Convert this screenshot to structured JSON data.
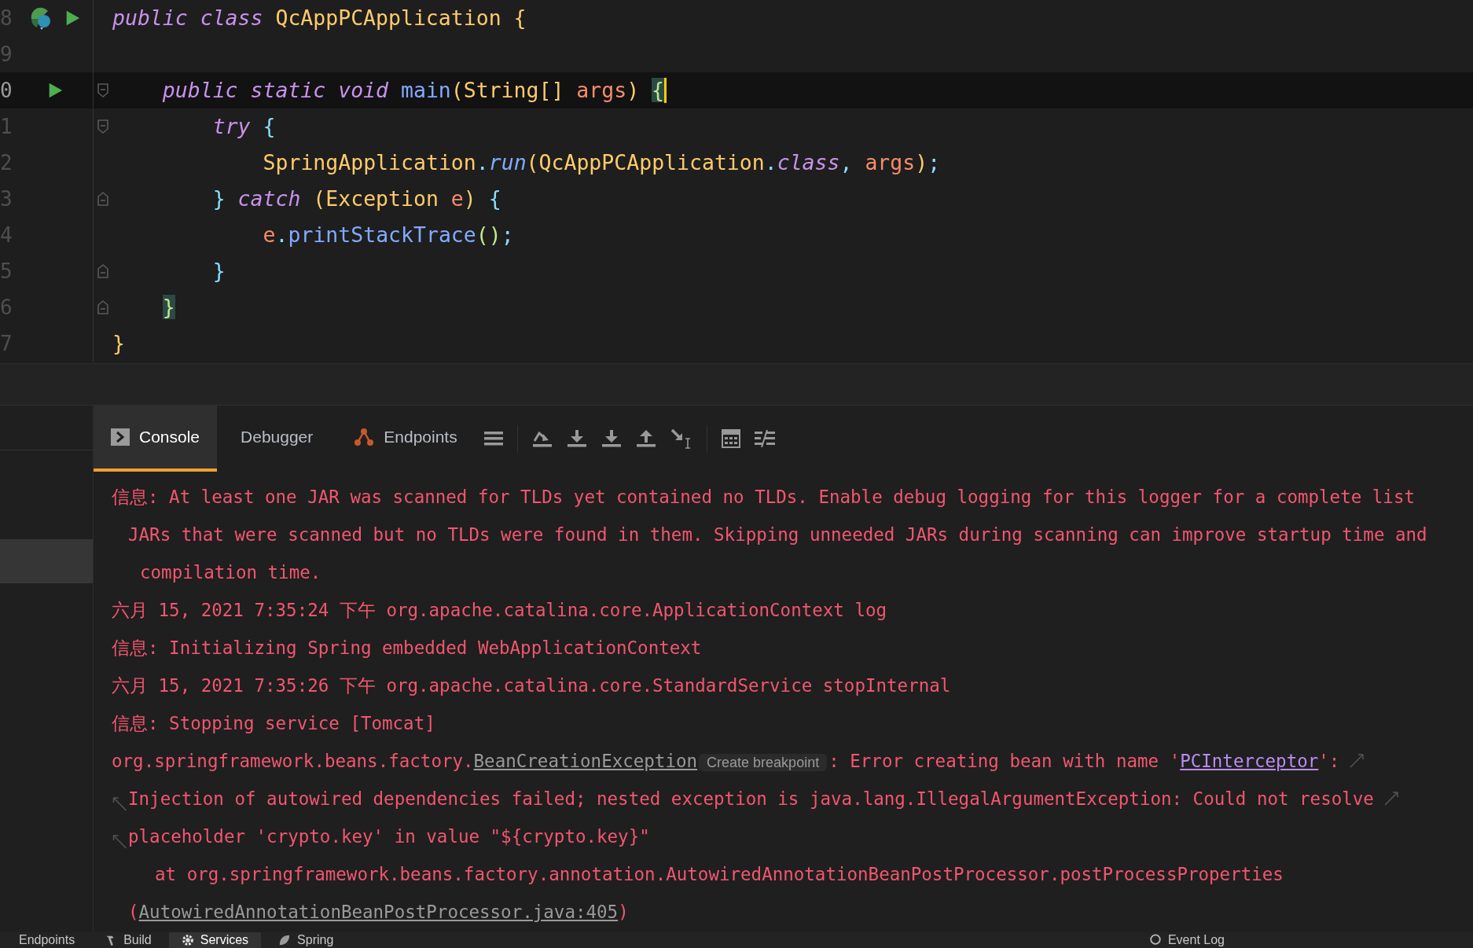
{
  "editor": {
    "lines": [
      {
        "number": "8",
        "gutter": [
          {
            "kind": "class"
          },
          {
            "kind": "run"
          }
        ],
        "kind": "top",
        "current": false,
        "caret": false,
        "tokens": [
          {
            "kind": "kw",
            "t": "public class "
          },
          {
            "kind": "type",
            "t": "QcAppPCApplication "
          },
          {
            "kind": "p1",
            "t": "{"
          }
        ]
      },
      {
        "number": "9",
        "kind": "top",
        "current": false,
        "caret": false
      },
      {
        "number": "0",
        "gutter": [
          {
            "kind": "run"
          }
        ],
        "fold": {
          "kind": "open"
        },
        "kind": "member",
        "current": true,
        "caret": true,
        "tokens": [
          {
            "kind": "kw",
            "t": "public static void "
          },
          {
            "kind": "fn",
            "t": "main"
          },
          {
            "kind": "p1",
            "t": "(String[] "
          },
          {
            "kind": "param",
            "t": "args"
          },
          {
            "kind": "p1",
            "t": ") "
          },
          {
            "kind": "match",
            "t": "{"
          }
        ]
      },
      {
        "number": "1",
        "fold": {
          "kind": "open"
        },
        "kind": "block",
        "current": false,
        "caret": false,
        "tokens": [
          {
            "kind": "kw",
            "t": "try "
          },
          {
            "kind": "p2",
            "t": "{"
          }
        ]
      },
      {
        "number": "2",
        "kind": "inner",
        "current": false,
        "caret": false,
        "tokens": [
          {
            "kind": "type",
            "t": "SpringApplication"
          },
          {
            "kind": "punct",
            "t": "."
          },
          {
            "kind": "fni",
            "t": "run"
          },
          {
            "kind": "p1",
            "t": "(QcAppPCApplication"
          },
          {
            "kind": "punct",
            "t": "."
          },
          {
            "kind": "kw",
            "t": "class"
          },
          {
            "kind": "punct",
            "t": ", "
          },
          {
            "kind": "param",
            "t": "args"
          },
          {
            "kind": "p1",
            "t": ")"
          },
          {
            "kind": "punct",
            "t": ";"
          }
        ]
      },
      {
        "number": "3",
        "fold": {
          "kind": "close"
        },
        "kind": "block",
        "current": false,
        "caret": false,
        "tokens": [
          {
            "kind": "p2",
            "t": "} "
          },
          {
            "kind": "kw",
            "t": "catch "
          },
          {
            "kind": "p1",
            "t": "(Exception "
          },
          {
            "kind": "param",
            "t": "e"
          },
          {
            "kind": "p1",
            "t": ") "
          },
          {
            "kind": "p2",
            "t": "{"
          }
        ]
      },
      {
        "number": "4",
        "kind": "inner",
        "current": false,
        "caret": false,
        "tokens": [
          {
            "kind": "param",
            "t": "e"
          },
          {
            "kind": "punct",
            "t": "."
          },
          {
            "kind": "fn",
            "t": "printStackTrace"
          },
          {
            "kind": "p3",
            "t": "()"
          },
          {
            "kind": "punct",
            "t": ";"
          }
        ]
      },
      {
        "number": "5",
        "fold": {
          "kind": "close"
        },
        "kind": "block",
        "current": false,
        "caret": false,
        "tokens": [
          {
            "kind": "p2",
            "t": "}"
          }
        ]
      },
      {
        "number": "6",
        "fold": {
          "kind": "close"
        },
        "kind": "member",
        "current": false,
        "caret": false,
        "tokens": [
          {
            "kind": "match",
            "t": "}"
          }
        ]
      },
      {
        "number": "7",
        "kind": "top",
        "current": false,
        "caret": false,
        "tokens": [
          {
            "kind": "p1",
            "t": "}"
          }
        ]
      }
    ]
  },
  "debug_toolbar": {
    "tabs": [
      {
        "label": "Console",
        "kind": "console",
        "selected": true
      },
      {
        "label": "Debugger",
        "kind": "plain",
        "selected": false
      },
      {
        "label": "Endpoints",
        "kind": "endpoints",
        "selected": false
      }
    ],
    "actions": [
      {
        "kind": "menu"
      },
      {
        "kind": "sep"
      },
      {
        "kind": "step-over"
      },
      {
        "kind": "step-into"
      },
      {
        "kind": "force-step-into"
      },
      {
        "kind": "step-out"
      },
      {
        "kind": "run-to-cursor"
      },
      {
        "kind": "sep"
      },
      {
        "kind": "evaluate"
      },
      {
        "kind": "trace"
      }
    ]
  },
  "console": {
    "lines": [
      {
        "kind": "line",
        "wrap_start": false,
        "wrap_end": false,
        "segments": [
          {
            "kind": "text",
            "t": "信息: At least one JAR was scanned for TLDs yet contained no TLDs. Enable debug logging for this logger for a complete list"
          }
        ]
      },
      {
        "kind": "wrap",
        "wrap_start": false,
        "wrap_end": false,
        "segments": [
          {
            "kind": "text",
            "t": "JARs that were scanned but no TLDs were found in them. Skipping unneeded JARs during scanning can improve startup time and"
          }
        ]
      },
      {
        "kind": "subwrap",
        "wrap_start": false,
        "wrap_end": false,
        "segments": [
          {
            "kind": "text",
            "t": "compilation time."
          }
        ]
      },
      {
        "kind": "line",
        "wrap_start": false,
        "wrap_end": false,
        "segments": [
          {
            "kind": "text",
            "t": "六月 15, 2021 7:35:24 下午 org.apache.catalina.core.ApplicationContext log"
          }
        ]
      },
      {
        "kind": "line",
        "wrap_start": false,
        "wrap_end": false,
        "segments": [
          {
            "kind": "text",
            "t": "信息: Initializing Spring embedded WebApplicationContext"
          }
        ]
      },
      {
        "kind": "line",
        "wrap_start": false,
        "wrap_end": false,
        "segments": [
          {
            "kind": "text",
            "t": "六月 15, 2021 7:35:26 下午 org.apache.catalina.core.StandardService stopInternal"
          }
        ]
      },
      {
        "kind": "line",
        "wrap_start": false,
        "wrap_end": false,
        "segments": [
          {
            "kind": "text",
            "t": "信息: Stopping service [Tomcat]"
          }
        ]
      },
      {
        "kind": "line",
        "wrap_start": false,
        "wrap_end": true,
        "segments": [
          {
            "kind": "text",
            "t": "org.springframework.beans.factory."
          },
          {
            "kind": "link",
            "t": "BeanCreationException"
          },
          {
            "kind": "hint",
            "t": "Create breakpoint"
          },
          {
            "kind": "text",
            "t": ": Error creating bean with name '"
          },
          {
            "kind": "class-link",
            "t": "PCInterceptor"
          },
          {
            "kind": "text",
            "t": "':"
          }
        ]
      },
      {
        "kind": "wrap",
        "wrap_start": true,
        "wrap_end": true,
        "segments": [
          {
            "kind": "text",
            "t": "Injection of autowired dependencies failed; nested exception is java.lang.IllegalArgumentException: Could not resolve"
          }
        ]
      },
      {
        "kind": "wrap",
        "wrap_start": true,
        "wrap_end": false,
        "segments": [
          {
            "kind": "text",
            "t": "placeholder 'crypto.key' in value \"${crypto.key}\""
          }
        ]
      },
      {
        "kind": "trace",
        "wrap_start": false,
        "wrap_end": false,
        "segments": [
          {
            "kind": "text",
            "t": "at org.springframework.beans.factory.annotation.AutowiredAnnotationBeanPostProcessor.postProcessProperties"
          }
        ]
      },
      {
        "kind": "wrap",
        "wrap_start": false,
        "wrap_end": false,
        "segments": [
          {
            "kind": "text",
            "t": "("
          },
          {
            "kind": "link",
            "t": "AutowiredAnnotationBeanPostProcessor.java:405"
          },
          {
            "kind": "text",
            "t": ")"
          }
        ]
      }
    ]
  },
  "tool_strip": {
    "left": [
      {
        "label": "Endpoints",
        "kind": "plain",
        "selected": false
      },
      {
        "label": "Build",
        "kind": "hammer",
        "selected": false
      },
      {
        "label": "Services",
        "kind": "services",
        "selected": true
      },
      {
        "label": "Spring",
        "kind": "leaf",
        "selected": false
      }
    ],
    "right": [
      {
        "label": "Event Log",
        "kind": "log",
        "selected": false
      }
    ]
  }
}
